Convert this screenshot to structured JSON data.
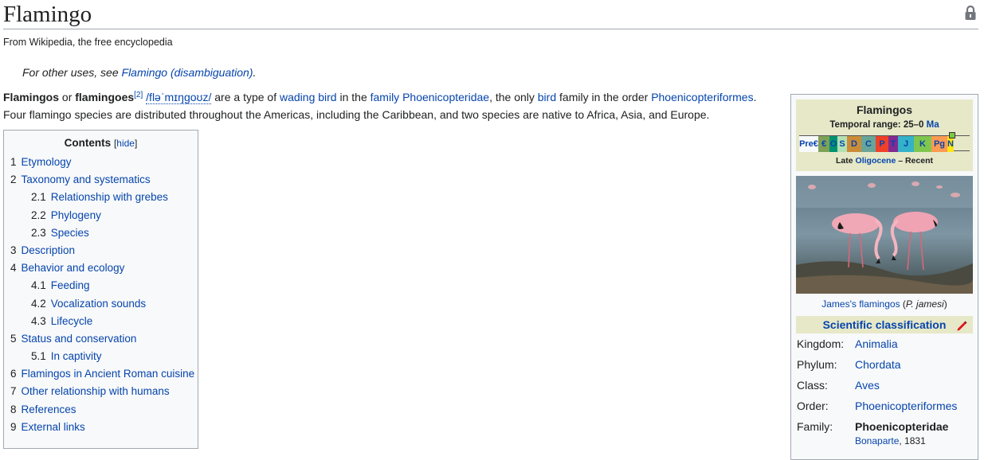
{
  "page": {
    "title": "Flamingo",
    "tagline": "From Wikipedia, the free encyclopedia",
    "hatnote_prefix": "For other uses, see ",
    "hatnote_link": "Flamingo (disambiguation)",
    "hatnote_suffix": "."
  },
  "lead": {
    "b1": "Flamingos",
    "t1": " or ",
    "b2": "flamingoes",
    "ref": "[2]",
    "ipa": "/fləˈmɪŋɡoʊz/",
    "t2": " are a type of ",
    "l1": "wading bird",
    "t3": " in the ",
    "l2": "family",
    "t4": " ",
    "l3": "Phoenicopteridae",
    "t5": ", the only ",
    "l4": "bird",
    "t6": " family in the order ",
    "l5": "Phoenicopteriformes",
    "t7": ".",
    "line2": "Four flamingo species are distributed throughout the Americas, including the Caribbean, and two species are native to Africa, Asia, and Europe."
  },
  "toc": {
    "title": "Contents",
    "hide_label": "[hide]",
    "items": [
      {
        "num": "1",
        "label": "Etymology",
        "level": 1
      },
      {
        "num": "2",
        "label": "Taxonomy and systematics",
        "level": 1
      },
      {
        "num": "2.1",
        "label": "Relationship with grebes",
        "level": 2
      },
      {
        "num": "2.2",
        "label": "Phylogeny",
        "level": 2
      },
      {
        "num": "2.3",
        "label": "Species",
        "level": 2
      },
      {
        "num": "3",
        "label": "Description",
        "level": 1
      },
      {
        "num": "4",
        "label": "Behavior and ecology",
        "level": 1
      },
      {
        "num": "4.1",
        "label": "Feeding",
        "level": 2
      },
      {
        "num": "4.2",
        "label": "Vocalization sounds",
        "level": 2
      },
      {
        "num": "4.3",
        "label": "Lifecycle",
        "level": 2
      },
      {
        "num": "5",
        "label": "Status and conservation",
        "level": 1
      },
      {
        "num": "5.1",
        "label": "In captivity",
        "level": 2
      },
      {
        "num": "6",
        "label": "Flamingos in Ancient Roman cuisine",
        "level": 1
      },
      {
        "num": "7",
        "label": "Other relationship with humans",
        "level": 1
      },
      {
        "num": "8",
        "label": "References",
        "level": 1
      },
      {
        "num": "9",
        "label": "External links",
        "level": 1
      }
    ]
  },
  "infobox": {
    "name": "Flamingos",
    "range_label": "Temporal range: 25–0 ",
    "range_unit": "Ma",
    "timeline": [
      {
        "label": "Pre€",
        "color": "#f8f9fa"
      },
      {
        "label": "€",
        "color": "#7fa056"
      },
      {
        "label": "O",
        "color": "#009270"
      },
      {
        "label": "S",
        "color": "#b3e1b6"
      },
      {
        "label": "D",
        "color": "#cb8c37"
      },
      {
        "label": "C",
        "color": "#67a599"
      },
      {
        "label": "P",
        "color": "#f04028"
      },
      {
        "label": "T",
        "color": "#812b92"
      },
      {
        "label": "J",
        "color": "#34b2c9"
      },
      {
        "label": "K",
        "color": "#7fc64e"
      },
      {
        "label": "Pg",
        "color": "#fd9a52"
      },
      {
        "label": "N",
        "color": "#ffe619"
      }
    ],
    "period_prefix": "Late ",
    "period_link": "Oligocene",
    "period_suffix": " – Recent",
    "caption_link": "James's flamingos",
    "caption_paren_open": " (",
    "caption_species": "P. jamesi",
    "caption_paren_close": ")",
    "sci_title": "Scientific classification",
    "taxonomy": [
      {
        "rank": "Kingdom:",
        "value": "Animalia",
        "bold": false
      },
      {
        "rank": "Phylum:",
        "value": "Chordata",
        "bold": false
      },
      {
        "rank": "Class:",
        "value": "Aves",
        "bold": false
      },
      {
        "rank": "Order:",
        "value": "Phoenicopteriformes",
        "bold": false
      },
      {
        "rank": "Family:",
        "value": "Phoenicopteridae",
        "bold": true
      }
    ],
    "authority_link": "Bonaparte",
    "authority_year": ", 1831"
  }
}
